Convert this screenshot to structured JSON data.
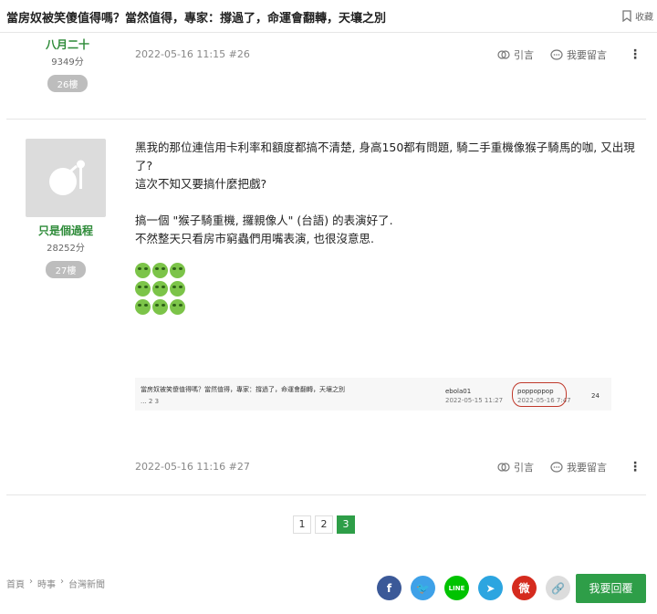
{
  "topbar": {
    "title": "當房奴被笑傻值得嗎？當然值得，專家：撐過了，命運會翻轉，天壤之別",
    "fav_label": "收藏"
  },
  "post26": {
    "author": "八月二十",
    "score": "9349分",
    "floor": "26樓",
    "meta": "2022-05-16 11:15 #26",
    "quote_label": "引言",
    "comment_label": "我要留言"
  },
  "post27": {
    "author": "只是個過程",
    "score": "28252分",
    "floor": "27樓",
    "lines": [
      "黑我的那位連信用卡利率和額度都搞不清楚, 身高150都有問題, 騎二手重機像猴子騎馬的咖, 又出現了?",
      "這次不知又要搞什麼把戲?",
      "",
      "搞一個 \"猴子騎重機, 攞親像人\" (台語) 的表演好了.",
      "不然整天只看房市窮蟲們用嘴表演, 也很沒意思."
    ],
    "emoji_name": "green-devil-emoji",
    "quote_image": {
      "thread_title": "當房奴被笑傻值得嗎？當然值得，專家：撐過了，命運會翻轉，天壤之別",
      "pages": "... 2 3",
      "user1": "ebola01",
      "date1": "2022-05-15 11:27",
      "user2": "poppoppop",
      "date2": "2022-05-16 7:47",
      "count": "24"
    },
    "meta": "2022-05-16 11:16 #27",
    "quote_label": "引言",
    "comment_label": "我要留言"
  },
  "pagination": {
    "pages": [
      "1",
      "2",
      "3"
    ],
    "current": "3"
  },
  "breadcrumb": [
    "首頁",
    "時事",
    "台灣新聞"
  ],
  "share": [
    {
      "name": "facebook",
      "color": "#3b5998",
      "glyph": "f"
    },
    {
      "name": "twitter",
      "color": "#3ea1e8",
      "glyph": "🐦"
    },
    {
      "name": "line",
      "color": "#00c300",
      "glyph": "LINE"
    },
    {
      "name": "telegram",
      "color": "#2ca5e0",
      "glyph": "➤"
    },
    {
      "name": "weibo",
      "color": "#d52b1e",
      "glyph": "微"
    },
    {
      "name": "link",
      "color": "#dcdcdc",
      "glyph": "🔗"
    }
  ],
  "reply_button": "我要回覆"
}
